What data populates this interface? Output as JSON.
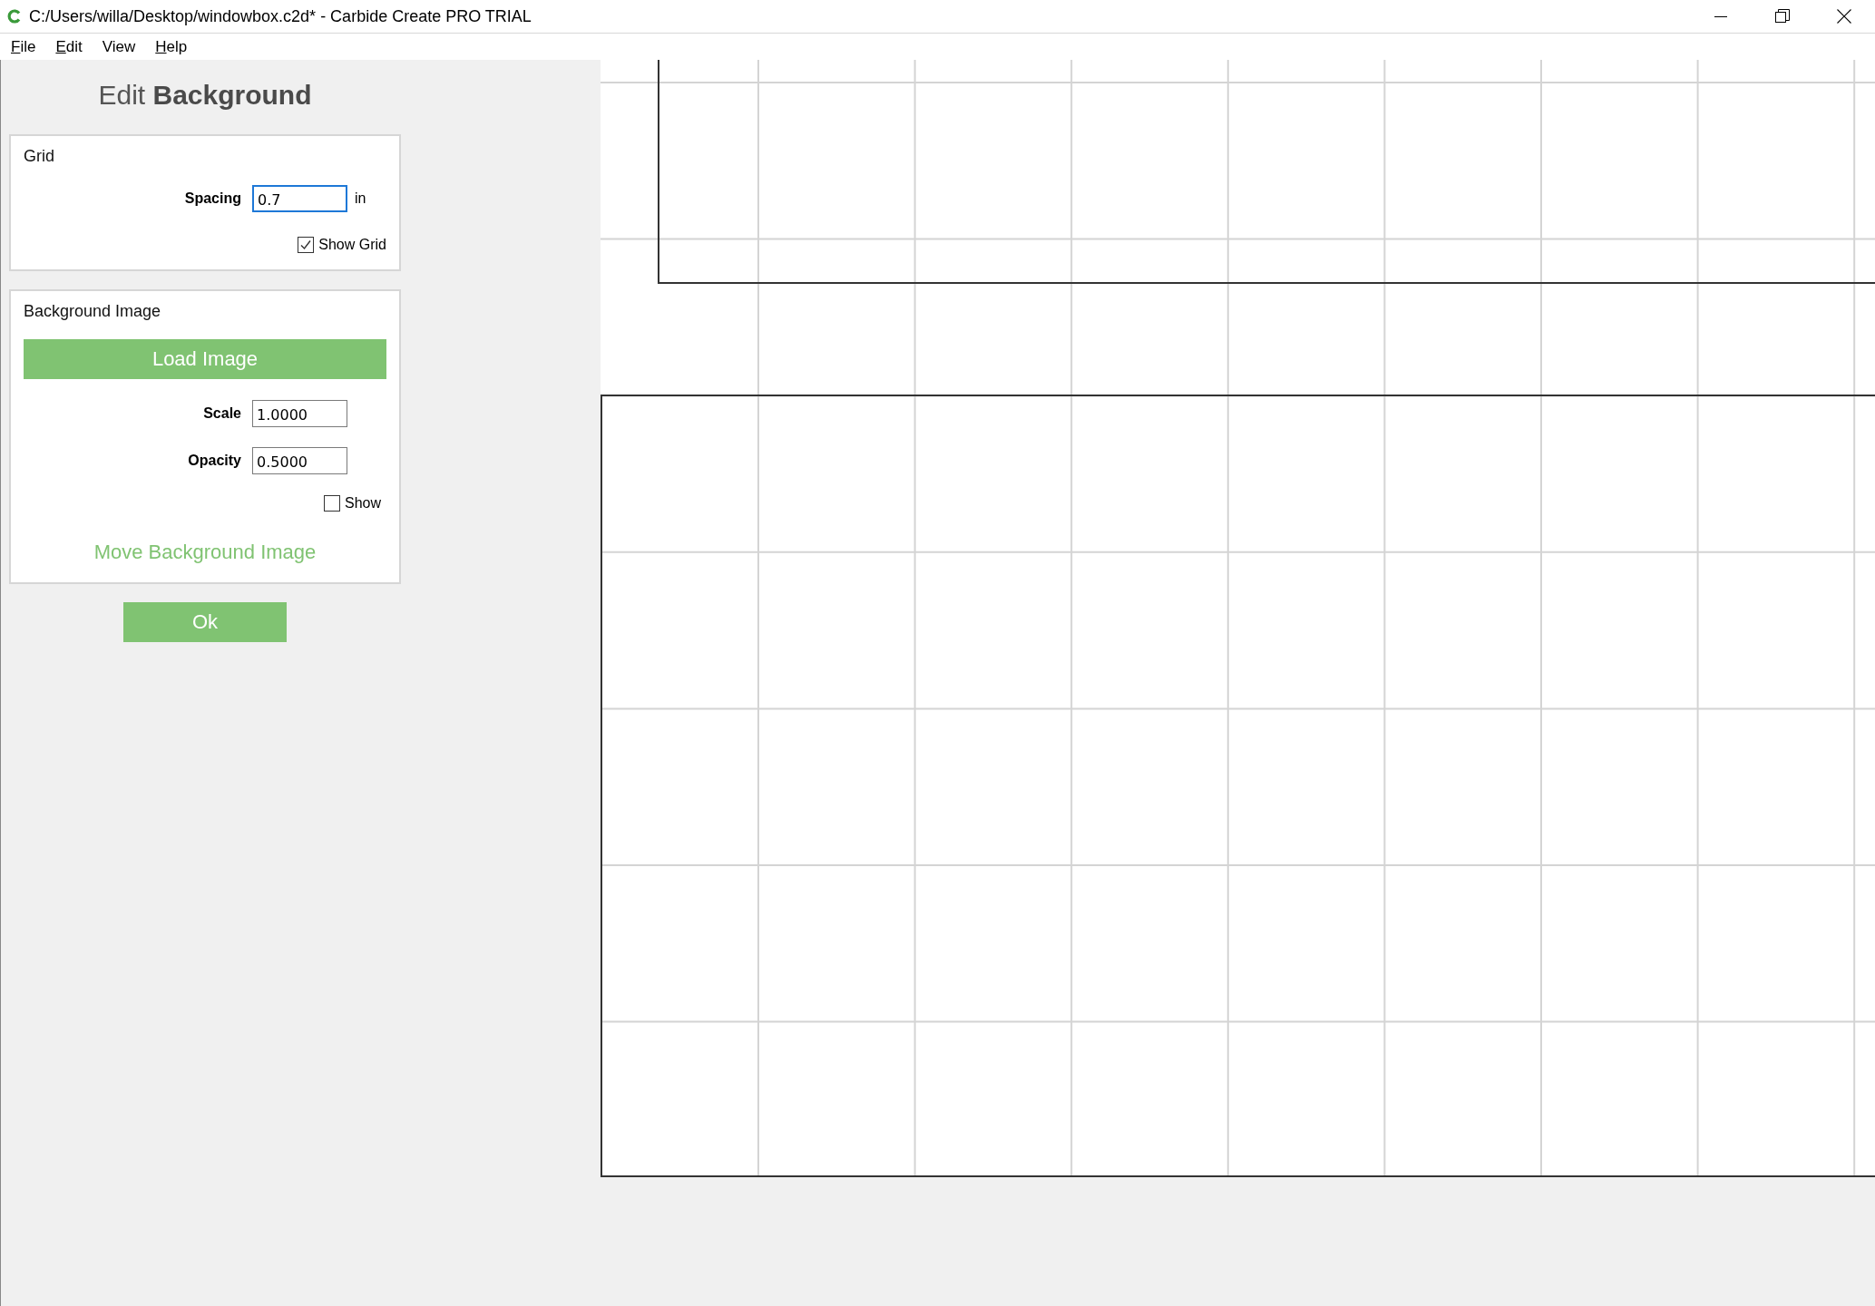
{
  "window": {
    "title": "C:/Users/willa/Desktop/windowbox.c2d* - Carbide Create PRO TRIAL"
  },
  "menu": [
    {
      "label": "File",
      "mnemonic": true
    },
    {
      "label": "Edit",
      "mnemonic": true
    },
    {
      "label": "View",
      "mnemonic": false
    },
    {
      "label": "Help",
      "mnemonic": true
    }
  ],
  "panel": {
    "title": "Edit **Background**",
    "grid": {
      "title": "Grid",
      "fields": [
        {
          "label": "Spacing",
          "value": "0.7",
          "unit": "in",
          "focused": true
        }
      ],
      "checkbox": {
        "label": "Show Grid",
        "checked": true
      }
    },
    "background_image": {
      "title": "Background Image",
      "load_button": "Load Image",
      "fields": [
        {
          "label": "Scale",
          "value": "1.0000",
          "focused": false
        },
        {
          "label": "Opacity",
          "value": "0.5000",
          "focused": false
        }
      ],
      "checkbox": {
        "label": "Show",
        "checked": false
      },
      "move_link": "Move Background Image"
    },
    "ok_button": "Ok"
  }
}
